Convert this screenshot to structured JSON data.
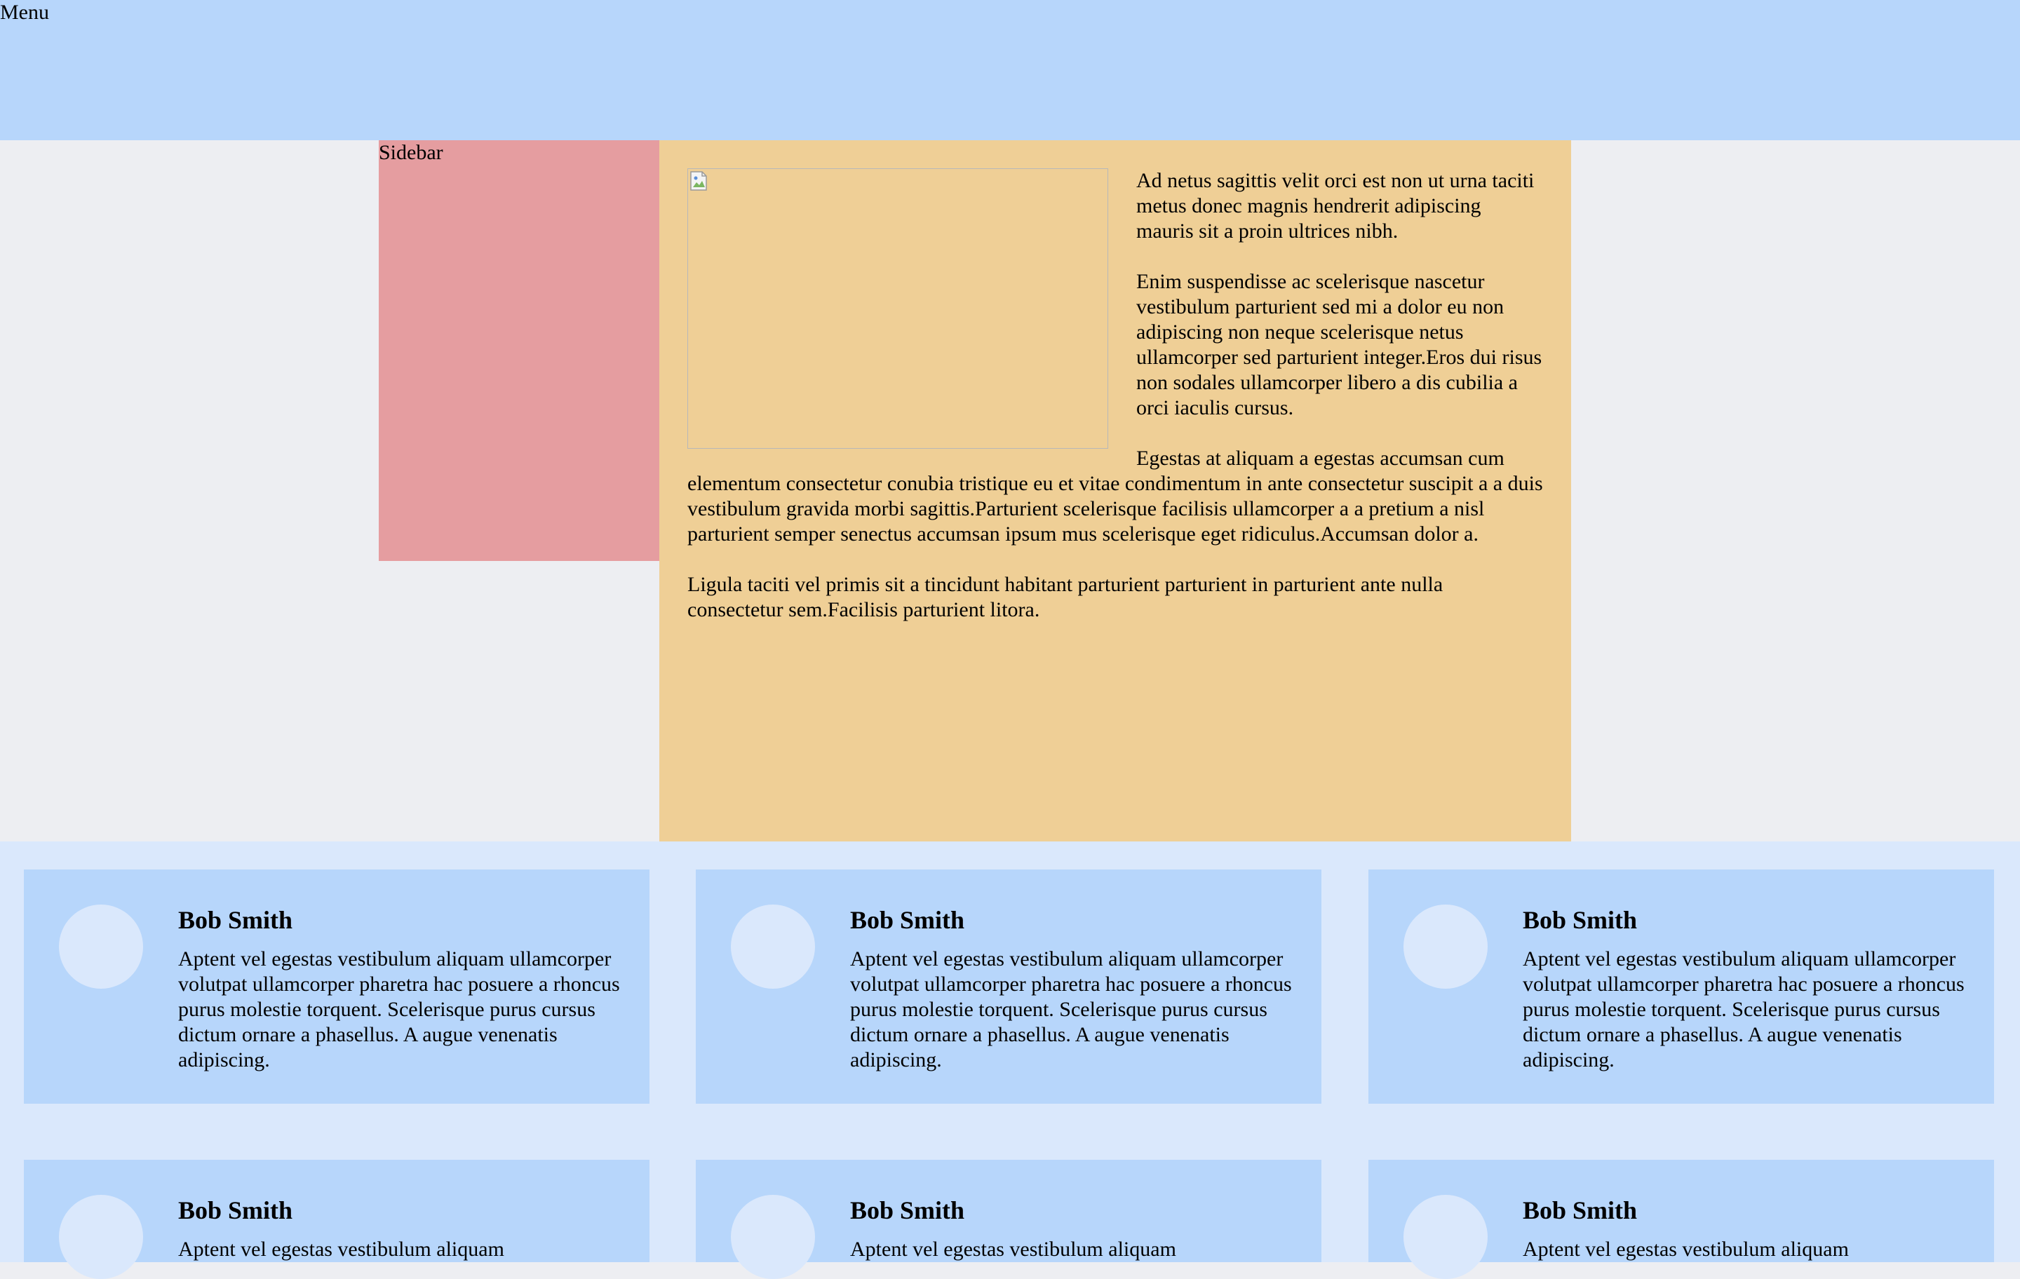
{
  "menu": {
    "label": "Menu"
  },
  "sidebar": {
    "label": "Sidebar"
  },
  "main": {
    "image": {
      "icon": "broken-image-icon"
    },
    "paragraphs": [
      "Ad netus sagittis velit orci est non ut urna taciti metus donec magnis hendrerit adipiscing mauris sit a proin ultrices nibh.",
      "Enim suspendisse ac scelerisque nascetur vestibulum parturient sed mi a dolor eu non adipiscing non neque scelerisque netus ullamcorper sed parturient integer.Eros dui risus non sodales ullamcorper libero a dis cubilia a orci iaculis cursus.",
      "Egestas at aliquam a egestas accumsan cum elementum consectetur conubia tristique eu et vitae condimentum in ante consectetur suscipit a a duis vestibulum gravida morbi sagittis.Parturient scelerisque facilisis ullamcorper a a pretium a nisl parturient semper senectus accumsan ipsum mus scelerisque eget ridiculus.Accumsan dolor a.",
      "Ligula taciti vel primis sit a tincidunt habitant parturient parturient in parturient ante nulla consectetur sem.Facilisis parturient litora."
    ]
  },
  "cards": [
    {
      "name": "Bob Smith",
      "bio": "Aptent vel egestas vestibulum aliquam ullamcorper volutpat ullamcorper pharetra hac posuere a rhoncus purus molestie torquent. Scelerisque purus cursus dictum ornare a phasellus. A augue venenatis adipiscing."
    },
    {
      "name": "Bob Smith",
      "bio": "Aptent vel egestas vestibulum aliquam ullamcorper volutpat ullamcorper pharetra hac posuere a rhoncus purus molestie torquent. Scelerisque purus cursus dictum ornare a phasellus. A augue venenatis adipiscing."
    },
    {
      "name": "Bob Smith",
      "bio": "Aptent vel egestas vestibulum aliquam ullamcorper volutpat ullamcorper pharetra hac posuere a rhoncus purus molestie torquent. Scelerisque purus cursus dictum ornare a phasellus. A augue venenatis adipiscing."
    },
    {
      "name": "Bob Smith",
      "bio": "Aptent vel egestas vestibulum aliquam"
    },
    {
      "name": "Bob Smith",
      "bio": "Aptent vel egestas vestibulum aliquam"
    },
    {
      "name": "Bob Smith",
      "bio": "Aptent vel egestas vestibulum aliquam"
    }
  ],
  "colors": {
    "page_background": "#edeef2",
    "menu_background": "#b7d6fb",
    "sidebar_background": "#e59da0",
    "main_background": "#efcf96",
    "people_section_background": "#dae8fc",
    "card_background": "#b7d6fb",
    "avatar_fill": "#dae8fc"
  }
}
